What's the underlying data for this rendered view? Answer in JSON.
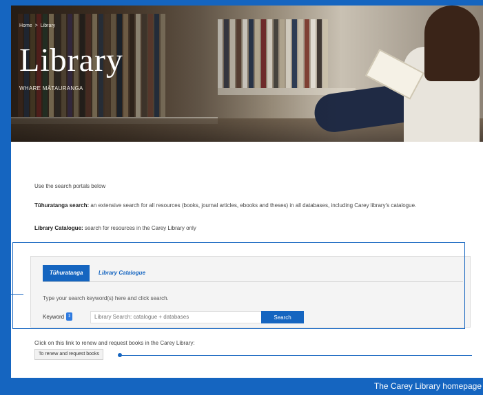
{
  "hero": {
    "breadcrumb": [
      "Home",
      ">",
      "Library"
    ],
    "title": "Library",
    "subtitle": "WHARE MĀTAURANGA"
  },
  "content": {
    "intro": "Use the search portals below",
    "p1_bold": "Tūhuratanga search:",
    "p1_text": " an extensive search for all resources (books, journal articles, ebooks and theses) in all databases, including Carey library's catalogue.",
    "p2_bold": "Library Catalogue:",
    "p2_text": " search for resources in the Carey Library only"
  },
  "search": {
    "tabs": [
      {
        "label": "Tūhuratanga",
        "active": true
      },
      {
        "label": "Library Catalogue",
        "active": false
      }
    ],
    "hint": "Type your search keyword(s) here and click search.",
    "field_type": "Keyword",
    "placeholder": "Library Search: catalogue + databases",
    "button": "Search"
  },
  "renew": {
    "text": "Click on this link to renew and request books in the Carey Library:",
    "button": "To renew and request books"
  },
  "annotation": {
    "label": "The Carey Library homepage"
  },
  "colors": {
    "accent": "#1565c0",
    "frame": "#1565c0"
  }
}
